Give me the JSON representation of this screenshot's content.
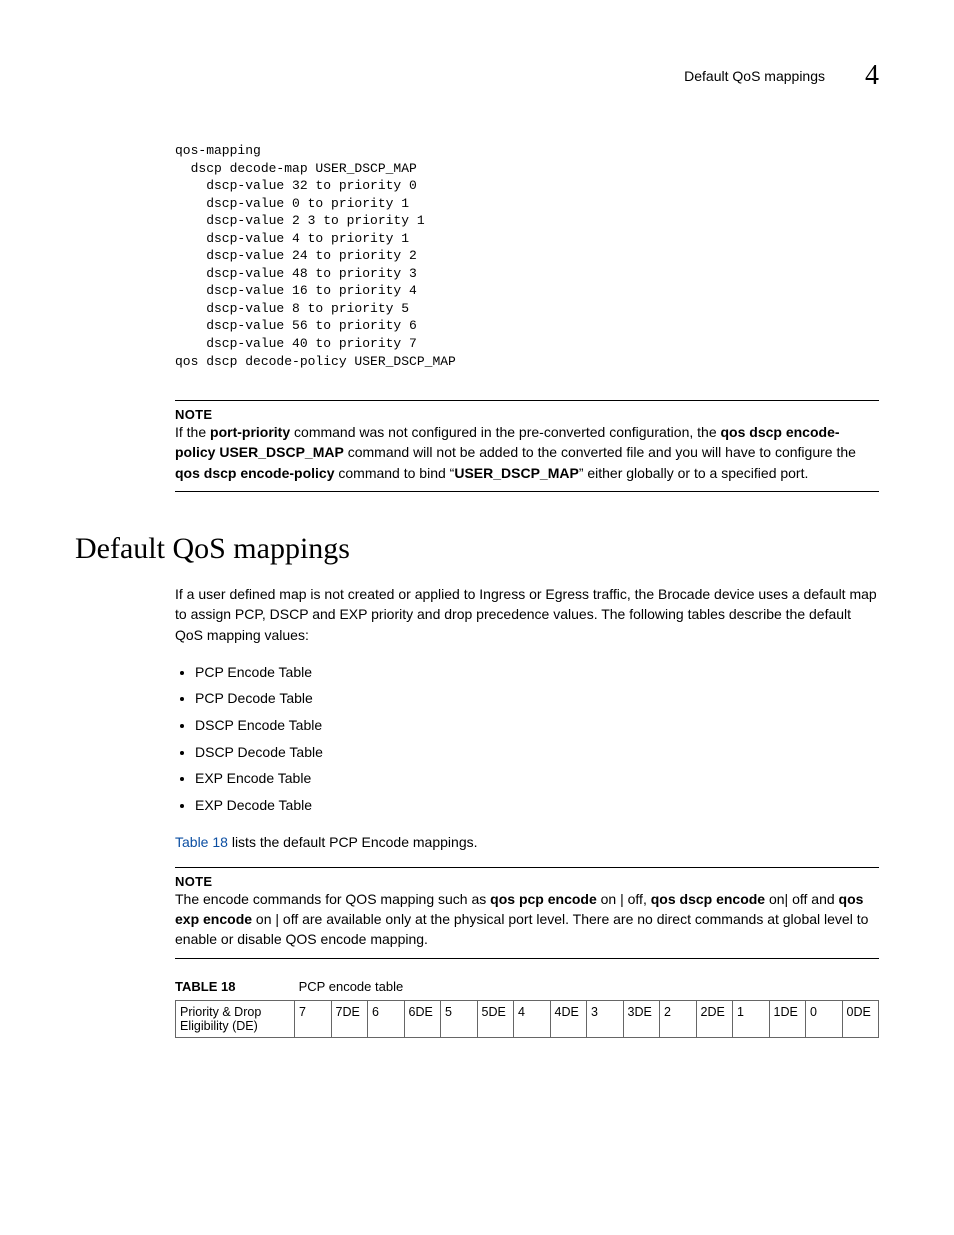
{
  "header": {
    "running_title": "Default QoS mappings",
    "chapter_number": "4"
  },
  "code_block": "qos-mapping\n  dscp decode-map USER_DSCP_MAP\n    dscp-value 32 to priority 0\n    dscp-value 0 to priority 1\n    dscp-value 2 3 to priority 1\n    dscp-value 4 to priority 1\n    dscp-value 24 to priority 2\n    dscp-value 48 to priority 3\n    dscp-value 16 to priority 4\n    dscp-value 8 to priority 5\n    dscp-value 56 to priority 6\n    dscp-value 40 to priority 7\nqos dscp decode-policy USER_DSCP_MAP",
  "note1": {
    "label": "NOTE",
    "t1": "If the ",
    "b1": "port-priority",
    "t2": " command was not configured in the pre-converted configuration, the ",
    "b2": "qos dscp encode-policy USER_DSCP_MAP",
    "t3": " command will not be added to the converted file and you will have to configure the ",
    "b3": "qos dscp encode-policy",
    "t4": " command to bind “",
    "b4": "USER_DSCP_MAP",
    "t5": "” either globally or to a specified port."
  },
  "section_heading": "Default QoS mappings",
  "intro_para": "If a user defined map is not created or applied to Ingress or Egress traffic, the Brocade device uses a default map to assign PCP, DSCP and EXP priority and drop precedence values. The following tables describe the default QoS mapping values:",
  "bullets": [
    "PCP Encode Table",
    "PCP Decode Table",
    "DSCP Encode Table",
    "DSCP Decode Table",
    "EXP Encode Table",
    "EXP Decode Table"
  ],
  "ref_line": {
    "link": "Table 18",
    "rest": " lists the default PCP Encode mappings."
  },
  "note2": {
    "label": "NOTE",
    "t1": "The encode commands for QOS mapping such as ",
    "b1": "qos pcp encode",
    "t2": " on | off, ",
    "b2": "qos dscp encode",
    "t3": " on| off and ",
    "b3": "qos exp encode",
    "t4": " on | off are available only at the physical port level. There are no direct commands at global level to enable or disable QOS encode mapping."
  },
  "table": {
    "caption_label": "TABLE 18",
    "caption_title": "PCP encode table",
    "row_header": "Priority & Drop Eligibility (DE)",
    "cells": [
      "7",
      "7DE",
      "6",
      "6DE",
      "5",
      "5DE",
      "4",
      "4DE",
      "3",
      "3DE",
      "2",
      "2DE",
      "1",
      "1DE",
      "0",
      "0DE"
    ]
  },
  "chart_data": {
    "type": "table",
    "title": "PCP encode table",
    "row_header": "Priority & Drop Eligibility (DE)",
    "columns": [
      "7",
      "7DE",
      "6",
      "6DE",
      "5",
      "5DE",
      "4",
      "4DE",
      "3",
      "3DE",
      "2",
      "2DE",
      "1",
      "1DE",
      "0",
      "0DE"
    ]
  }
}
